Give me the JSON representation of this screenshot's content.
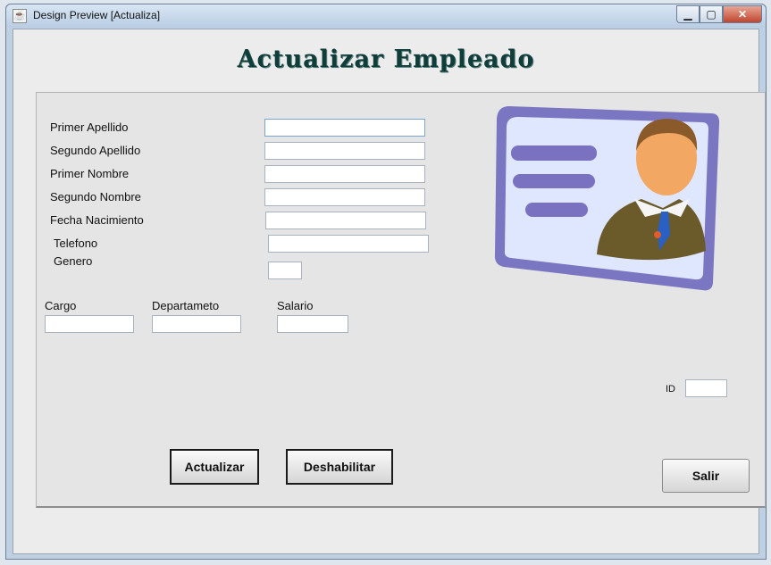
{
  "window": {
    "title": "Design Preview [Actualiza]",
    "icon": "java-cup-icon",
    "min": "▁",
    "max": "▢",
    "close": "✕"
  },
  "form": {
    "heading": "Actualizar Empleado",
    "fields": {
      "primer_apellido": {
        "label": "Primer Apellido",
        "value": ""
      },
      "segundo_apellido": {
        "label": "Segundo Apellido",
        "value": ""
      },
      "primer_nombre": {
        "label": "Primer Nombre",
        "value": ""
      },
      "segundo_nombre": {
        "label": "Segundo Nombre",
        "value": ""
      },
      "fecha_nacimiento": {
        "label": "Fecha Nacimiento",
        "value": ""
      },
      "telefono": {
        "label": "Telefono",
        "value": ""
      },
      "genero": {
        "label": "Genero",
        "value": ""
      },
      "cargo": {
        "label": "Cargo",
        "value": ""
      },
      "departamento": {
        "label": "Departameto",
        "value": ""
      },
      "salario": {
        "label": "Salario",
        "value": ""
      },
      "id": {
        "label": "ID",
        "value": ""
      }
    },
    "buttons": {
      "actualizar": "Actualizar",
      "deshabilitar": "Deshabilitar",
      "salir": "Salir"
    }
  },
  "colors": {
    "heading": "#0f3d3a",
    "badge_frame": "#7b76c2",
    "badge_fill": "#dfe7ff",
    "suit": "#6b5a2a",
    "tie": "#2a5fc4"
  }
}
